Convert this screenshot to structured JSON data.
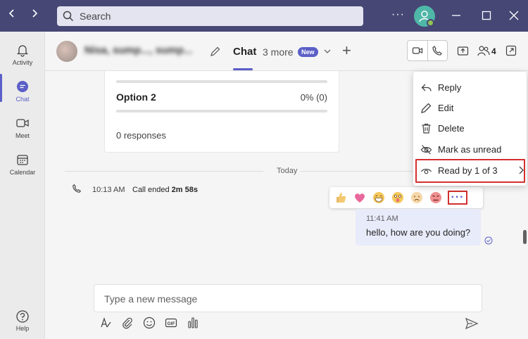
{
  "titlebar": {
    "search_placeholder": "Search",
    "more_label": "···"
  },
  "rail": {
    "items": [
      {
        "label": "Activity",
        "icon": "bell-icon"
      },
      {
        "label": "Chat",
        "icon": "chat-icon"
      },
      {
        "label": "Meet",
        "icon": "video-icon"
      },
      {
        "label": "Calendar",
        "icon": "calendar-icon"
      }
    ],
    "help_label": "Help"
  },
  "header": {
    "chat_name": "Nisa, sump..., sump...",
    "tab_chat": "Chat",
    "tab_more": "3 more",
    "badge_new": "New",
    "plus": "+",
    "people_count": "4"
  },
  "poll": {
    "option2_label": "Option 2",
    "option2_value": "0% (0)",
    "responses": "0 responses"
  },
  "conversation": {
    "divider_label": "Today",
    "call_time": "10:13 AM",
    "call_prefix": "Call ended",
    "call_duration": "2m 58s",
    "message_time": "11:41 AM",
    "message_text": "hello, how are you doing?"
  },
  "reactions": [
    "thumbs-up",
    "heart",
    "laugh",
    "surprised",
    "sad",
    "angry"
  ],
  "context_menu": {
    "items": [
      {
        "label": "Reply",
        "icon": "reply-icon"
      },
      {
        "label": "Edit",
        "icon": "pencil-icon"
      },
      {
        "label": "Delete",
        "icon": "trash-icon"
      },
      {
        "label": "Mark as unread",
        "icon": "eye-off-icon"
      },
      {
        "label": "Read by 1 of 3",
        "icon": "eye-icon"
      }
    ]
  },
  "compose": {
    "placeholder": "Type a new message"
  },
  "colors": {
    "titlebar": "#464775",
    "accent": "#5b5fc7",
    "highlight_box": "#d32f2f"
  }
}
